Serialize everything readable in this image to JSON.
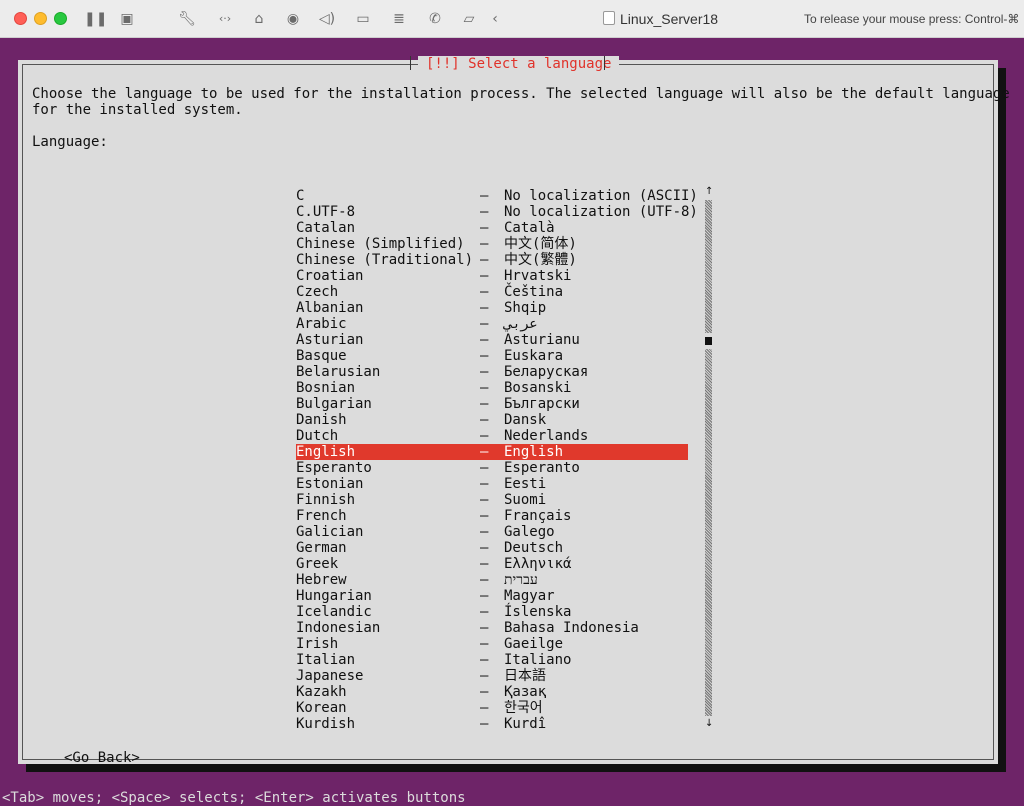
{
  "window": {
    "title": "Linux_Server18",
    "release_hint": "To release your mouse press: Control-⌘",
    "toolbar_icons": [
      "pause-icon",
      "snapshot-icon",
      "wrench-icon",
      "code-arrows-icon",
      "hard-disk-icon",
      "camera-lock-icon",
      "sound-icon",
      "video-icon",
      "storage-icon",
      "phone-off-icon",
      "folder-share-icon",
      "back-chevron-icon"
    ]
  },
  "dialog": {
    "title": "[!!] Select a language",
    "intro_line1": "Choose the language to be used for the installation process. The selected language will also be the default language",
    "intro_line2": "for the installed system.",
    "language_label": "Language:",
    "languages": [
      {
        "name": "C",
        "native": "No localization (ASCII)"
      },
      {
        "name": "C.UTF-8",
        "native": "No localization (UTF-8)"
      },
      {
        "name": "Catalan",
        "native": "Català"
      },
      {
        "name": "Chinese (Simplified)",
        "native": "中文(简体)"
      },
      {
        "name": "Chinese (Traditional)",
        "native": "中文(繁體)"
      },
      {
        "name": "Croatian",
        "native": "Hrvatski"
      },
      {
        "name": "Czech",
        "native": "Čeština"
      },
      {
        "name": "Albanian",
        "native": "Shqip"
      },
      {
        "name": "Arabic",
        "native": "عربي"
      },
      {
        "name": "Asturian",
        "native": "Asturianu"
      },
      {
        "name": "Basque",
        "native": "Euskara"
      },
      {
        "name": "Belarusian",
        "native": "Беларуская"
      },
      {
        "name": "Bosnian",
        "native": "Bosanski"
      },
      {
        "name": "Bulgarian",
        "native": "Български"
      },
      {
        "name": "Danish",
        "native": "Dansk"
      },
      {
        "name": "Dutch",
        "native": "Nederlands"
      },
      {
        "name": "English",
        "native": "English"
      },
      {
        "name": "Esperanto",
        "native": "Esperanto"
      },
      {
        "name": "Estonian",
        "native": "Eesti"
      },
      {
        "name": "Finnish",
        "native": "Suomi"
      },
      {
        "name": "French",
        "native": "Français"
      },
      {
        "name": "Galician",
        "native": "Galego"
      },
      {
        "name": "German",
        "native": "Deutsch"
      },
      {
        "name": "Greek",
        "native": "Ελληνικά"
      },
      {
        "name": "Hebrew",
        "native": "עברית"
      },
      {
        "name": "Hungarian",
        "native": "Magyar"
      },
      {
        "name": "Icelandic",
        "native": "Íslenska"
      },
      {
        "name": "Indonesian",
        "native": "Bahasa Indonesia"
      },
      {
        "name": "Irish",
        "native": "Gaeilge"
      },
      {
        "name": "Italian",
        "native": "Italiano"
      },
      {
        "name": "Japanese",
        "native": "日本語"
      },
      {
        "name": "Kazakh",
        "native": "Қазақ"
      },
      {
        "name": "Korean",
        "native": "한국어"
      },
      {
        "name": "Kurdish",
        "native": "Kurdî"
      }
    ],
    "separator": "–",
    "selected_index": 16,
    "scroll_up": "↑",
    "scroll_down": "↓",
    "scroll_position": 0.27,
    "go_back_label": "<Go Back>"
  },
  "status_hint": "<Tab> moves; <Space> selects; <Enter> activates buttons",
  "colors": {
    "screen_bg": "#6e2468",
    "dialog_bg": "#dcdcdc",
    "title_red": "#e0322a",
    "selection": "#e0392c"
  }
}
